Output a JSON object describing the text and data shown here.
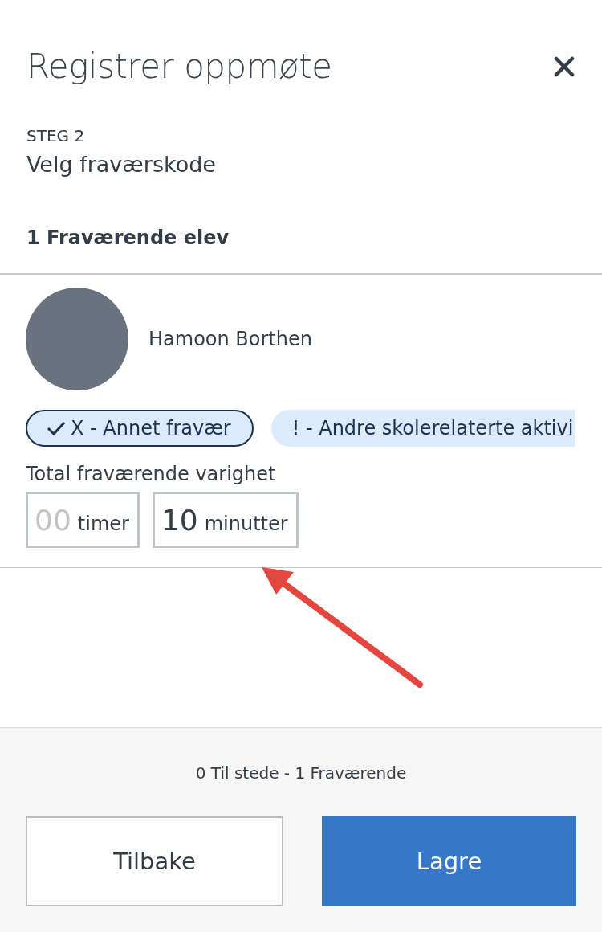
{
  "dialog": {
    "title": "Registrer oppmøte"
  },
  "step": {
    "label": "STEG 2",
    "title": "Velg fraværskode"
  },
  "absent_heading": "1 Fraværende elev",
  "students": [
    {
      "name": "Hamoon Borthen",
      "codes": [
        {
          "label": "X - Annet fravær",
          "selected": true
        },
        {
          "label": "! - Andre skolerelaterte aktivi",
          "selected": false
        }
      ],
      "duration": {
        "label": "Total fraværende varighet",
        "fields": [
          {
            "placeholder": "00",
            "unit": "timer"
          },
          {
            "value": "10",
            "unit": "minutter"
          }
        ]
      }
    }
  ],
  "footer": {
    "summary": "0 Til stede - 1 Fraværende",
    "buttons": [
      {
        "label": "Tilbake",
        "kind": "secondary"
      },
      {
        "label": "Lagre",
        "kind": "primary"
      }
    ]
  }
}
